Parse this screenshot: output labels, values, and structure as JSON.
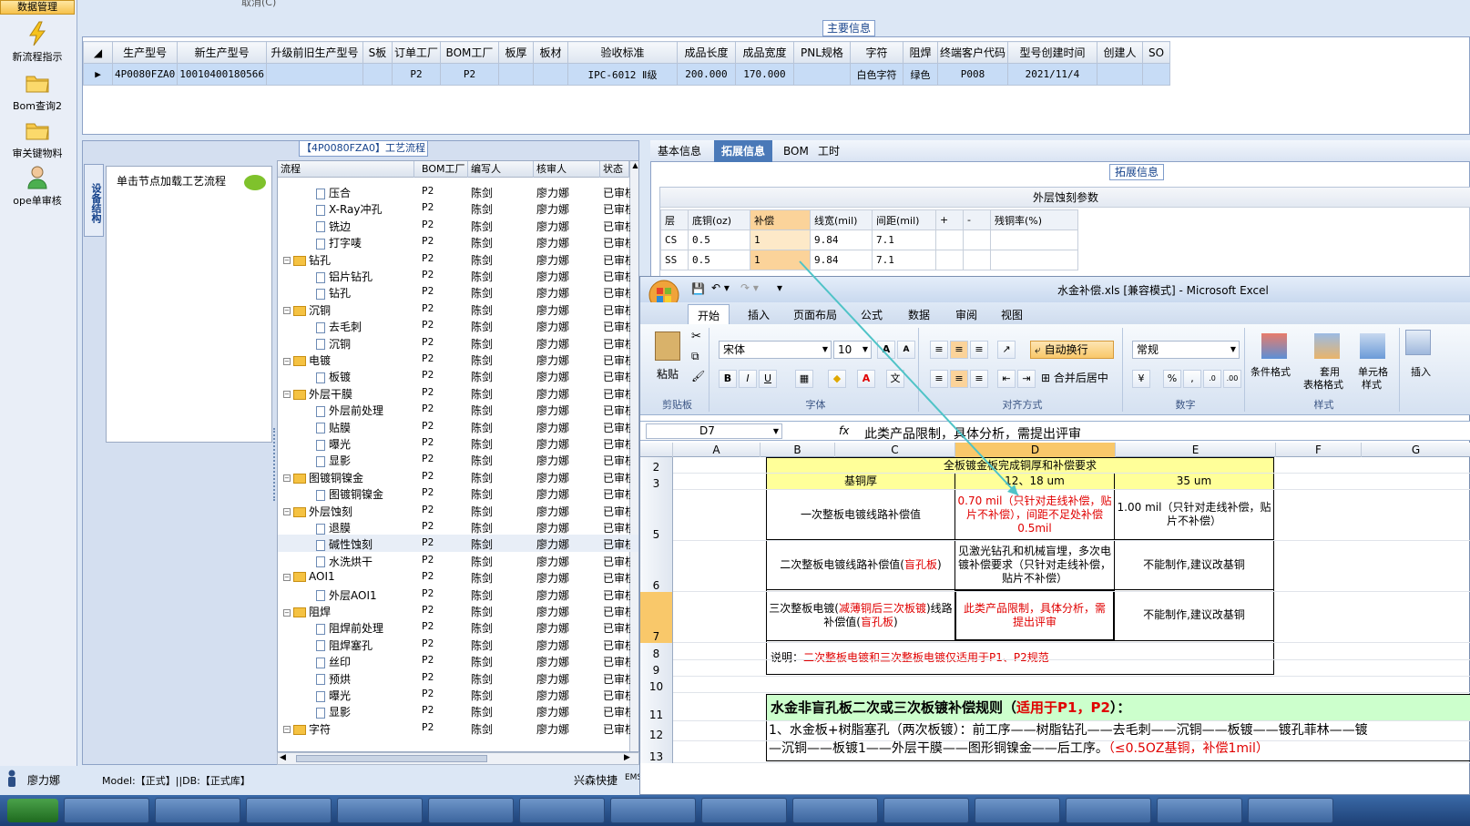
{
  "sidebar": {
    "top_label": "数据管理",
    "items": [
      {
        "label": "新流程指示",
        "icon": "lightning-icon"
      },
      {
        "label": "Bom查询2",
        "icon": "folder-icon"
      },
      {
        "label": "审关键物料",
        "icon": "folder-icon"
      },
      {
        "label": "ope单审核",
        "icon": "user-icon"
      }
    ]
  },
  "top_cut_text": "取消(C)",
  "main_info": {
    "caption": "主要信息",
    "headers": [
      "生产型号",
      "新生产型号",
      "升级前旧生产型号",
      "S板",
      "订单工厂",
      "BOM工厂",
      "板厚",
      "板材",
      "验收标准",
      "成品长度",
      "成品宽度",
      "PNL规格",
      "字符",
      "阻焊",
      "终端客户代码",
      "型号创建时间",
      "创建人",
      "SO"
    ],
    "row": [
      "4P0080FZA0",
      "10010400180566",
      "",
      "",
      "P2",
      "P2",
      "",
      "",
      "IPC-6012 Ⅱ级",
      "200.000",
      "170.000",
      "",
      "白色字符",
      "绿色",
      "P008",
      "2021/11/4",
      "",
      ""
    ]
  },
  "process": {
    "caption": "【4P0080FZA0】工艺流程",
    "vertical_tab": "设备结构",
    "hint": "单击节点加载工艺流程",
    "headers": [
      "流程",
      "BOM工厂",
      "编写人",
      "核审人",
      "状态"
    ],
    "rows": [
      {
        "name": "压合",
        "level": 2,
        "type": "doc",
        "bom": "P2",
        "writer": "陈剑",
        "reviewer": "廖力娜",
        "status": "已审核"
      },
      {
        "name": "X-Ray冲孔",
        "level": 2,
        "type": "doc",
        "bom": "P2",
        "writer": "陈剑",
        "reviewer": "廖力娜",
        "status": "已审核"
      },
      {
        "name": "铣边",
        "level": 2,
        "type": "doc",
        "bom": "P2",
        "writer": "陈剑",
        "reviewer": "廖力娜",
        "status": "已审核"
      },
      {
        "name": "打字唛",
        "level": 2,
        "type": "doc",
        "bom": "P2",
        "writer": "陈剑",
        "reviewer": "廖力娜",
        "status": "已审核"
      },
      {
        "name": "钻孔",
        "level": 1,
        "type": "folder",
        "bom": "P2",
        "writer": "陈剑",
        "reviewer": "廖力娜",
        "status": "已审核"
      },
      {
        "name": "铝片钻孔",
        "level": 2,
        "type": "doc",
        "bom": "P2",
        "writer": "陈剑",
        "reviewer": "廖力娜",
        "status": "已审核"
      },
      {
        "name": "钻孔",
        "level": 2,
        "type": "doc",
        "bom": "P2",
        "writer": "陈剑",
        "reviewer": "廖力娜",
        "status": "已审核"
      },
      {
        "name": "沉铜",
        "level": 1,
        "type": "folder",
        "bom": "P2",
        "writer": "陈剑",
        "reviewer": "廖力娜",
        "status": "已审核"
      },
      {
        "name": "去毛刺",
        "level": 2,
        "type": "doc",
        "bom": "P2",
        "writer": "陈剑",
        "reviewer": "廖力娜",
        "status": "已审核"
      },
      {
        "name": "沉铜",
        "level": 2,
        "type": "doc",
        "bom": "P2",
        "writer": "陈剑",
        "reviewer": "廖力娜",
        "status": "已审核"
      },
      {
        "name": "电镀",
        "level": 1,
        "type": "folder",
        "bom": "P2",
        "writer": "陈剑",
        "reviewer": "廖力娜",
        "status": "已审核"
      },
      {
        "name": "板镀",
        "level": 2,
        "type": "doc",
        "bom": "P2",
        "writer": "陈剑",
        "reviewer": "廖力娜",
        "status": "已审核"
      },
      {
        "name": "外层干膜",
        "level": 1,
        "type": "folder",
        "bom": "P2",
        "writer": "陈剑",
        "reviewer": "廖力娜",
        "status": "已审核"
      },
      {
        "name": "外层前处理",
        "level": 2,
        "type": "doc",
        "bom": "P2",
        "writer": "陈剑",
        "reviewer": "廖力娜",
        "status": "已审核"
      },
      {
        "name": "贴膜",
        "level": 2,
        "type": "doc",
        "bom": "P2",
        "writer": "陈剑",
        "reviewer": "廖力娜",
        "status": "已审核"
      },
      {
        "name": "曝光",
        "level": 2,
        "type": "doc",
        "bom": "P2",
        "writer": "陈剑",
        "reviewer": "廖力娜",
        "status": "已审核"
      },
      {
        "name": "显影",
        "level": 2,
        "type": "doc",
        "bom": "P2",
        "writer": "陈剑",
        "reviewer": "廖力娜",
        "status": "已审核"
      },
      {
        "name": "图镀铜镍金",
        "level": 1,
        "type": "folder",
        "bom": "P2",
        "writer": "陈剑",
        "reviewer": "廖力娜",
        "status": "已审核"
      },
      {
        "name": "图镀铜镍金",
        "level": 2,
        "type": "doc",
        "bom": "P2",
        "writer": "陈剑",
        "reviewer": "廖力娜",
        "status": "已审核"
      },
      {
        "name": "外层蚀刻",
        "level": 1,
        "type": "folder",
        "bom": "P2",
        "writer": "陈剑",
        "reviewer": "廖力娜",
        "status": "已审核"
      },
      {
        "name": "退膜",
        "level": 2,
        "type": "doc",
        "bom": "P2",
        "writer": "陈剑",
        "reviewer": "廖力娜",
        "status": "已审核"
      },
      {
        "name": "碱性蚀刻",
        "level": 2,
        "type": "doc",
        "bom": "P2",
        "writer": "陈剑",
        "reviewer": "廖力娜",
        "status": "已审核",
        "selected": true
      },
      {
        "name": "水洗烘干",
        "level": 2,
        "type": "doc",
        "bom": "P2",
        "writer": "陈剑",
        "reviewer": "廖力娜",
        "status": "已审核"
      },
      {
        "name": "AOI1",
        "level": 1,
        "type": "folder",
        "bom": "P2",
        "writer": "陈剑",
        "reviewer": "廖力娜",
        "status": "已审核"
      },
      {
        "name": "外层AOI1",
        "level": 2,
        "type": "doc",
        "bom": "P2",
        "writer": "陈剑",
        "reviewer": "廖力娜",
        "status": "已审核"
      },
      {
        "name": "阻焊",
        "level": 1,
        "type": "folder",
        "bom": "P2",
        "writer": "陈剑",
        "reviewer": "廖力娜",
        "status": "已审核"
      },
      {
        "name": "阻焊前处理",
        "level": 2,
        "type": "doc",
        "bom": "P2",
        "writer": "陈剑",
        "reviewer": "廖力娜",
        "status": "已审核"
      },
      {
        "name": "阻焊塞孔",
        "level": 2,
        "type": "doc",
        "bom": "P2",
        "writer": "陈剑",
        "reviewer": "廖力娜",
        "status": "已审核"
      },
      {
        "name": "丝印",
        "level": 2,
        "type": "doc",
        "bom": "P2",
        "writer": "陈剑",
        "reviewer": "廖力娜",
        "status": "已审核"
      },
      {
        "name": "预烘",
        "level": 2,
        "type": "doc",
        "bom": "P2",
        "writer": "陈剑",
        "reviewer": "廖力娜",
        "status": "已审核"
      },
      {
        "name": "曝光",
        "level": 2,
        "type": "doc",
        "bom": "P2",
        "writer": "陈剑",
        "reviewer": "廖力娜",
        "status": "已审核"
      },
      {
        "name": "显影",
        "level": 2,
        "type": "doc",
        "bom": "P2",
        "writer": "陈剑",
        "reviewer": "廖力娜",
        "status": "已审核"
      },
      {
        "name": "字符",
        "level": 1,
        "type": "folder",
        "bom": "P2",
        "writer": "陈剑",
        "reviewer": "廖力娜",
        "status": "已审核"
      }
    ]
  },
  "right_panel": {
    "tabs": [
      "基本信息",
      "拓展信息",
      "BOM",
      "工时"
    ],
    "active_tab": "拓展信息",
    "caption": "拓展信息",
    "table_title": "外层蚀刻参数",
    "headers": [
      "层",
      "底铜(oz)",
      "补偿",
      "线宽(mil)",
      "间距(mil)",
      "+",
      "-",
      "残铜率(%)"
    ],
    "rows": [
      [
        "CS",
        "0.5",
        "1",
        "9.84",
        "7.1",
        "",
        "",
        ""
      ],
      [
        "SS",
        "0.5",
        "1",
        "9.84",
        "7.1",
        "",
        "",
        ""
      ]
    ]
  },
  "excel": {
    "title": "水金补偿.xls  [兼容模式] - Microsoft Excel",
    "menu": [
      "开始",
      "插入",
      "页面布局",
      "公式",
      "数据",
      "审阅",
      "视图"
    ],
    "ribbon": {
      "paste": "粘贴",
      "clipboard": "剪贴板",
      "font_name": "宋体",
      "font_size": "10",
      "font_group": "字体",
      "wrap": "自动换行",
      "merge": "合并后居中",
      "align_group": "对齐方式",
      "number_format": "常规",
      "number_group": "数字",
      "cond_format": "条件格式",
      "table_format_1": "套用",
      "table_format_2": "表格格式",
      "cell_style_1": "单元格",
      "cell_style_2": "样式",
      "styles_group": "样式",
      "insert": "插入"
    },
    "name_box": "D7",
    "formula": "此类产品限制，具体分析，需提出评审",
    "columns": [
      "A",
      "B",
      "C",
      "D",
      "E",
      "F",
      "G"
    ],
    "row_numbers": [
      "2",
      "3",
      "5",
      "6",
      "7",
      "8",
      "9",
      "10",
      "11",
      "12",
      "13"
    ],
    "table": {
      "title": "全板镀金板完成铜厚和补偿要求",
      "h_base": "基铜厚",
      "h_12": "12、18 um",
      "h_35": "35 um",
      "r1_label": "一次整板电镀线路补偿值",
      "r1_d": "0.70 mil（只针对走线补偿，贴片不补偿），间距不足处补偿0.5mil",
      "r1_e": "1.00 mil（只针对走线补偿，贴片不补偿）",
      "r2_label_a": "二次整板电镀线路补偿值(",
      "r2_label_b": "盲孔板",
      "r2_label_c": ")",
      "r2_d": "见激光钻孔和机械盲埋，多次电镀补偿要求（只针对走线补偿，贴片不补偿）",
      "r2_e": "不能制作,建议改基铜",
      "r3_label_a": "三次整板电镀(",
      "r3_label_b": "减薄铜后三次板镀",
      "r3_label_c": ")线路补偿值(",
      "r3_label_d": "盲孔板",
      "r3_label_e": ")",
      "r3_d": "此类产品限制，具体分析，需提出评审",
      "r3_e": "不能制作,建议改基铜",
      "note_a": "说明：",
      "note_b": "二次整板电镀和三次整板电镀仅适用于P1、P2规范"
    },
    "rule_title_a": "水金非盲孔板二次或三次板镀补偿规则（",
    "rule_title_b": "适用于P1，P2",
    "rule_title_c": "）：",
    "rule_line1": "1、水金板+树脂塞孔（两次板镀）：前工序——树脂钻孔——去毛刺——沉铜——板镀——镀孔菲林——镀",
    "rule_line2_a": "—沉铜——板镀1——外层干膜——图形铜镍金——后工序。",
    "rule_line2_b": "（≤0.5OZ基铜，补偿1mil）"
  },
  "status": {
    "user": "廖力娜",
    "model_info": "Model:【正式】||DB:【正式库】",
    "company": "兴森快捷",
    "ems": "EMS"
  },
  "colors": {
    "selection_row": "#c7dcf6",
    "highlight_cell": "#fbd39a",
    "excel_header_yellow": "#ffff99",
    "rule_green": "#ccffcc",
    "red_text": "#e00000",
    "arrow": "#4fc3c7"
  }
}
